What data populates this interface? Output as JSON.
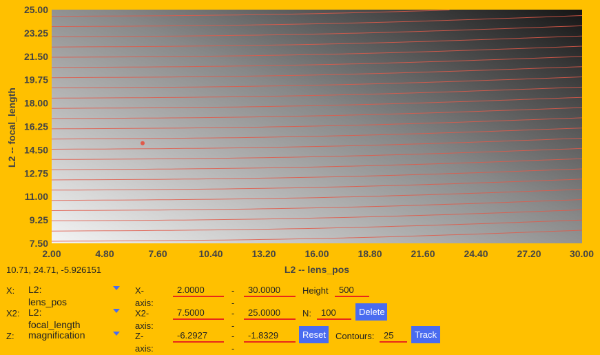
{
  "chart_data": {
    "type": "heatmap",
    "xlabel": "L2 -- lens_pos",
    "ylabel": "L2 -- focal_length",
    "xlim": [
      2.0,
      30.0
    ],
    "ylim": [
      7.5,
      25.0
    ],
    "x_ticks": [
      "2.00",
      "4.80",
      "7.60",
      "10.40",
      "13.20",
      "16.00",
      "18.80",
      "21.60",
      "24.40",
      "27.20",
      "30.00"
    ],
    "y_ticks": [
      "7.50",
      "9.25",
      "11.00",
      "12.75",
      "14.50",
      "16.25",
      "18.00",
      "19.75",
      "21.50",
      "23.25",
      "25.00"
    ],
    "z_range": [
      -6.2927,
      -1.8329
    ],
    "contours": 25,
    "colormap": "grayscale (light = low, dark = high)",
    "contour_color": "#e05a4a",
    "marker": {
      "x": 6.8,
      "y": 15.0,
      "color": "#e05a4a"
    }
  },
  "readout": "10.71, 24.71, -5.926151",
  "controls": {
    "x": {
      "label": "X:",
      "value": "L2: lens_pos"
    },
    "x2": {
      "label": "X2:",
      "value": "L2: focal_length"
    },
    "z": {
      "label": "Z:",
      "value": "magnification"
    },
    "xaxis": {
      "label": "X-axis:",
      "min": "2.0000",
      "sep": "--",
      "max": "30.0000"
    },
    "x2axis": {
      "label": "X2-axis:",
      "min": "7.5000",
      "sep": "--",
      "max": "25.0000"
    },
    "zaxis": {
      "label": "Z-axis:",
      "min": "-6.2927",
      "sep": "--",
      "max": "-1.8329"
    },
    "height": {
      "label": "Height",
      "value": "500"
    },
    "n": {
      "label": "N:",
      "value": "100"
    },
    "contours": {
      "label": "Contours:",
      "value": "25"
    },
    "buttons": {
      "delete": "Delete",
      "reset": "Reset",
      "track": "Track"
    }
  },
  "colors": {
    "background": "#FFC000",
    "button": "#4a6cf0",
    "underline": "#e8281a"
  }
}
